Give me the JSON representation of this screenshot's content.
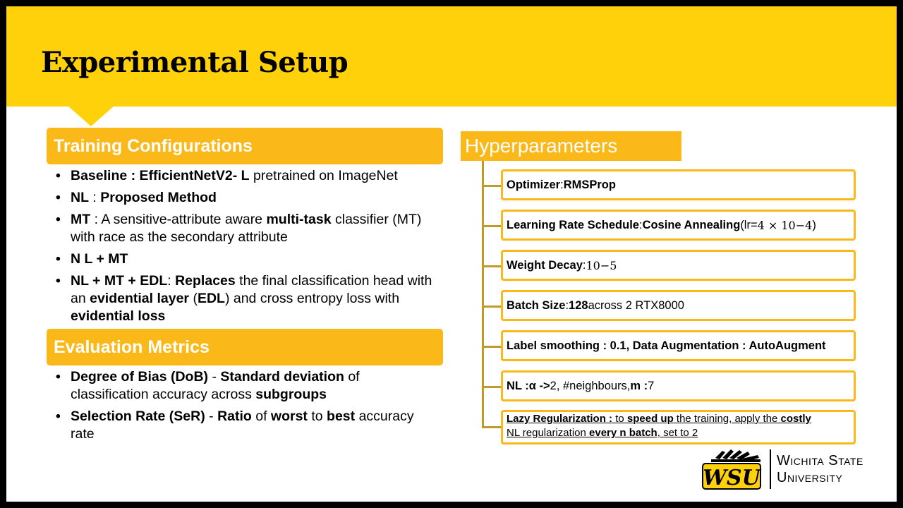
{
  "title": "Experimental Setup",
  "training": {
    "heading": "Training Configurations",
    "items": [
      {
        "a_bold": "Baseline : EfficientNetV2- L",
        "a_rest": " pretrained on ImageNet"
      },
      {
        "a_bold": "NL",
        "a_rest": " : ",
        "b_bold": "Proposed Method"
      },
      {
        "a_bold": "MT",
        "a_rest": " : A sensitive-attribute aware ",
        "b_bold": "multi-task",
        "b_rest": " classifier (MT) with race as the secondary attribute"
      },
      {
        "a_bold": "N L + MT"
      },
      {
        "a_bold": "NL + MT + EDL",
        "a_rest": ":  ",
        "b_bold": "Replaces",
        "b_rest": " the final classification  head with an ",
        "c_bold": "evidential layer",
        "c_rest": " (",
        "d_bold": "EDL",
        "d_rest": ") and cross entropy loss with ",
        "e_bold": "evidential loss"
      }
    ]
  },
  "evaluation": {
    "heading": "Evaluation Metrics",
    "items": [
      {
        "a_bold": "Degree of Bias (DoB)",
        "a_rest": "  - ",
        "b_bold": "Standard deviation",
        "b_rest": " of classification accuracy across ",
        "c_bold": "subgroups"
      },
      {
        "a_bold": "Selection Rate (SeR)",
        "a_rest": "  - ",
        "b_bold": "Ratio",
        "b_rest": " of ",
        "c_bold": "worst",
        "c_rest": " to ",
        "d_bold": "best",
        "d_rest": " accuracy rate"
      }
    ]
  },
  "hyper": {
    "heading": "Hyperparameters",
    "optimizer": {
      "label": "Optimizer",
      "sep": " : ",
      "value": "RMSProp"
    },
    "lr": {
      "label": "Learning Rate Schedule",
      "sep": " : ",
      "value": "Cosine Annealing",
      "paren_open": "  (lr=",
      "math_base": "4 × 10",
      "math_exp": "−4",
      "paren_close": ")"
    },
    "wd": {
      "label": "Weight Decay",
      "sep": " : ",
      "math_base": "10",
      "math_exp": "−5"
    },
    "batch": {
      "label": "Batch Size",
      "sep": " : ",
      "value": "128",
      "rest": " across 2 RTX8000"
    },
    "smoothing": {
      "text": "Label smoothing : 0.1, Data Augmentation : AutoAugment"
    },
    "nl": {
      "label": "NL :  ",
      "alpha": "α ->",
      "alpha_val": " 2, #neighbours, ",
      "m": "m :",
      "m_val": " 7"
    },
    "lazy": {
      "label": "Lazy Regularization :",
      "p1": " to ",
      "b1": "speed up",
      "p2": " the training, apply the ",
      "b2": "costly",
      "p3": "NL regularization ",
      "b3": "every n batch",
      "p4": ", set to 2"
    }
  },
  "university": {
    "line1": "Wichita State",
    "line2": "University",
    "logo_text": "WSU"
  },
  "colors": {
    "gold": "#FFD10A",
    "accent": "#FBB819",
    "connector": "#C09A2D"
  }
}
